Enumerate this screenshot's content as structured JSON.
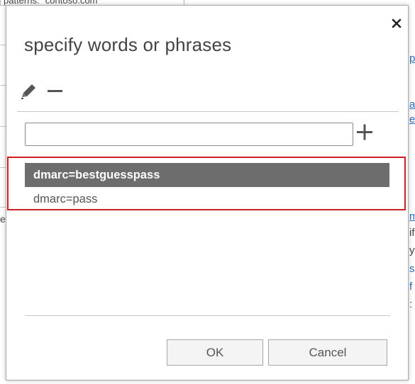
{
  "background": {
    "top_strip_text": "patterns: \"contoso.com\"",
    "right_fragments": [
      "p",
      "a",
      "es",
      "m",
      "if",
      "y",
      "s",
      "f",
      ":"
    ],
    "left_fragment": "e"
  },
  "dialog": {
    "title": "specify words or phrases",
    "close_glyph": "✕",
    "input": {
      "value": "",
      "placeholder": ""
    },
    "phrases": [
      {
        "text": "dmarc=bestguesspass",
        "selected": true
      },
      {
        "text": "dmarc=pass",
        "selected": false
      }
    ],
    "ok_label": "OK",
    "cancel_label": "Cancel"
  },
  "icons": {
    "close": "close-icon",
    "edit": "pencil-icon",
    "remove": "minus-icon",
    "add": "plus-icon"
  },
  "colors": {
    "highlight_border": "#cc1f1f",
    "selected_row": "#6d6d6d",
    "link": "#2a6ebb"
  }
}
